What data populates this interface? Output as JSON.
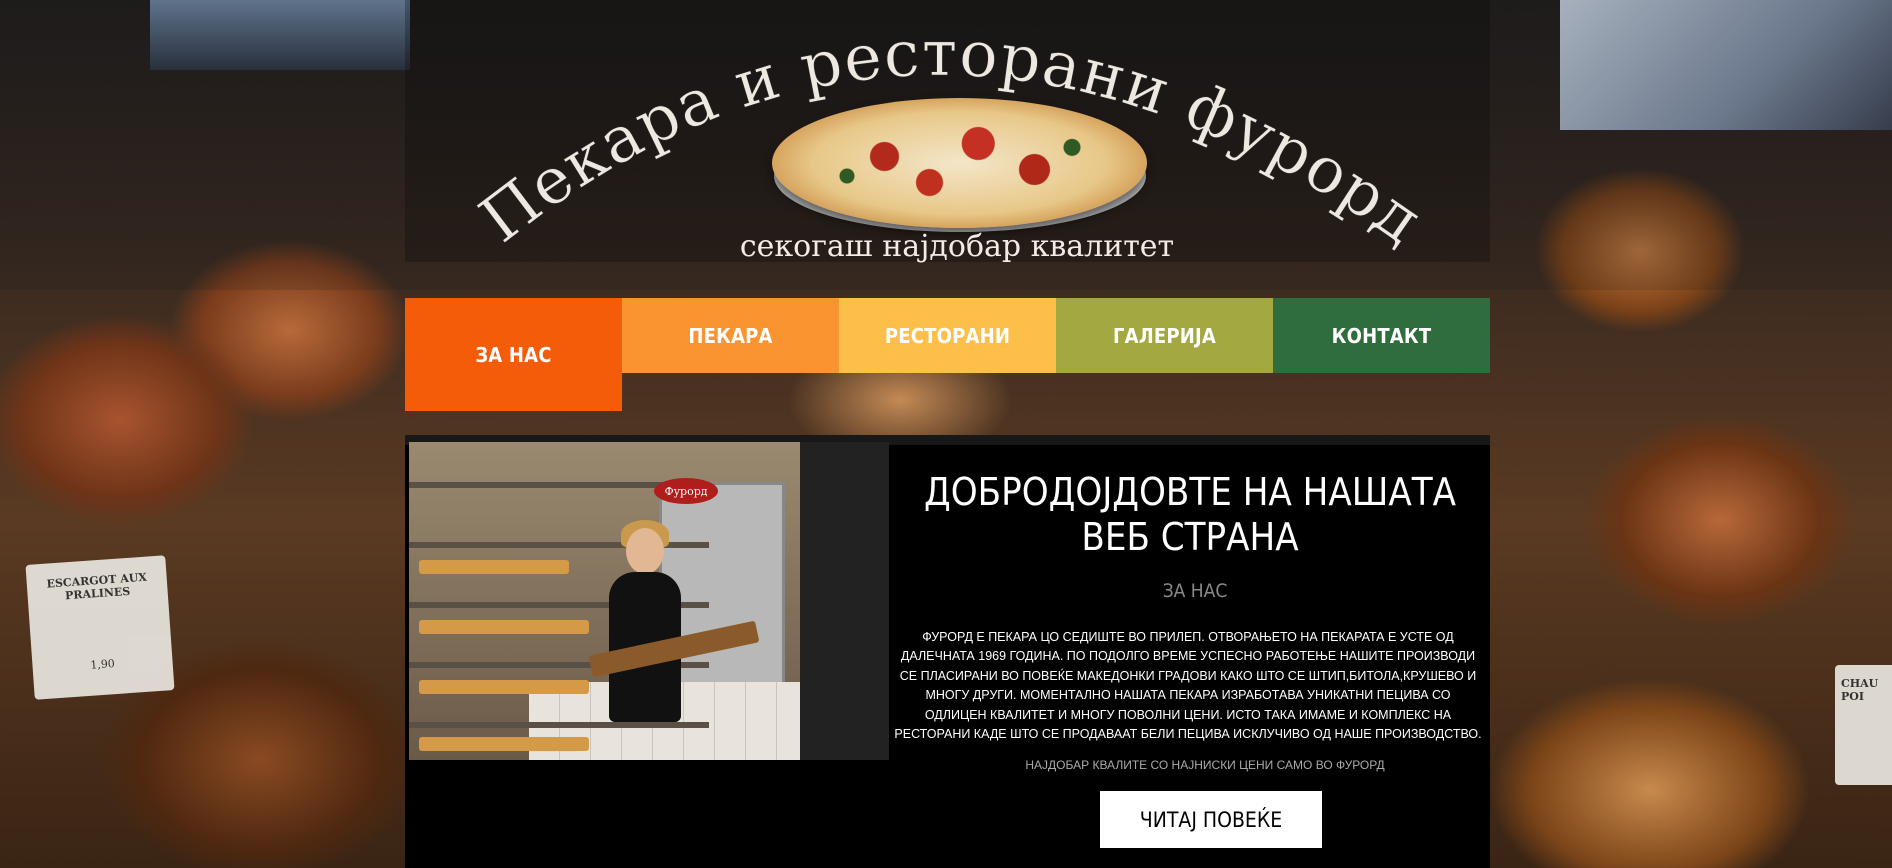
{
  "header": {
    "logo_title": "Пекара и ресторани фурорд",
    "logo_tagline": "секогаш најдобар квалитет"
  },
  "nav": {
    "items": [
      {
        "label": "ЗА НАС",
        "color": "#f55c0a"
      },
      {
        "label": "ПЕКАРА",
        "color": "#f99530"
      },
      {
        "label": "РЕСТОРАНИ",
        "color": "#fcbf4a"
      },
      {
        "label": "ГАЛЕРИЈА",
        "color": "#a3a940"
      },
      {
        "label": "КОНТАКТ",
        "color": "#2f6d3c"
      }
    ],
    "active_index": 0
  },
  "main": {
    "heading": "ДОБРОДОЈДОВТЕ НА НАШАТА ВЕБ СТРАНА",
    "subheading": "ЗА НАС",
    "body": "ФУРОРД Е ПЕКАРА ЦО СЕДИШТЕ ВО ПРИЛЕП. ОТВОРАЊЕТО НА ПЕКАРАТА Е УСТЕ ОД ДАЛЕЧНАТА 1969 ГОДИНА. ПО ПОДОЛГО ВРЕМЕ УСПЕСНО РАБОТЕЊЕ НАШИТЕ ПРОИЗВОДИ СЕ ПЛАСИРАНИ ВО ПОВЕЌЕ МАКЕДОНКИ ГРАДОВИ КАКО ШТО СЕ ШТИП,БИТОЛА,КРУШЕВО И МНОГУ ДРУГИ. МОМЕНТАЛНО НАШАТА ПЕКАРА ИЗРАБОТАВА УНИКАТНИ ПЕЦИВА СО ОДЛИЦЕН КВАЛИТЕТ И МНОГУ ПОВОЛНИ ЦЕНИ. ИСТО ТАКА ИМАМЕ И КОМПЛЕКС НА РЕСТОРАНИ КАДЕ ШТО СЕ ПРОДАВААТ БЕЛИ ПЕЦИВА ИСКЛУЧИВО ОД НАШЕ ПРОИЗВОДСТВО.",
    "tagline": "НАЈДОБАР КВАЛИТЕ СО НАЈНИСКИ ЦЕНИ САМО ВО ФУРОРД",
    "button_label": "ЧИТАЈ ПОВЕЌЕ",
    "photo_sign": "Фурорд"
  },
  "background": {
    "sign_left": "ESCARGOT AUX PRALINES",
    "sign_left_price": "1,90",
    "sign_right": "CHAU POI"
  }
}
